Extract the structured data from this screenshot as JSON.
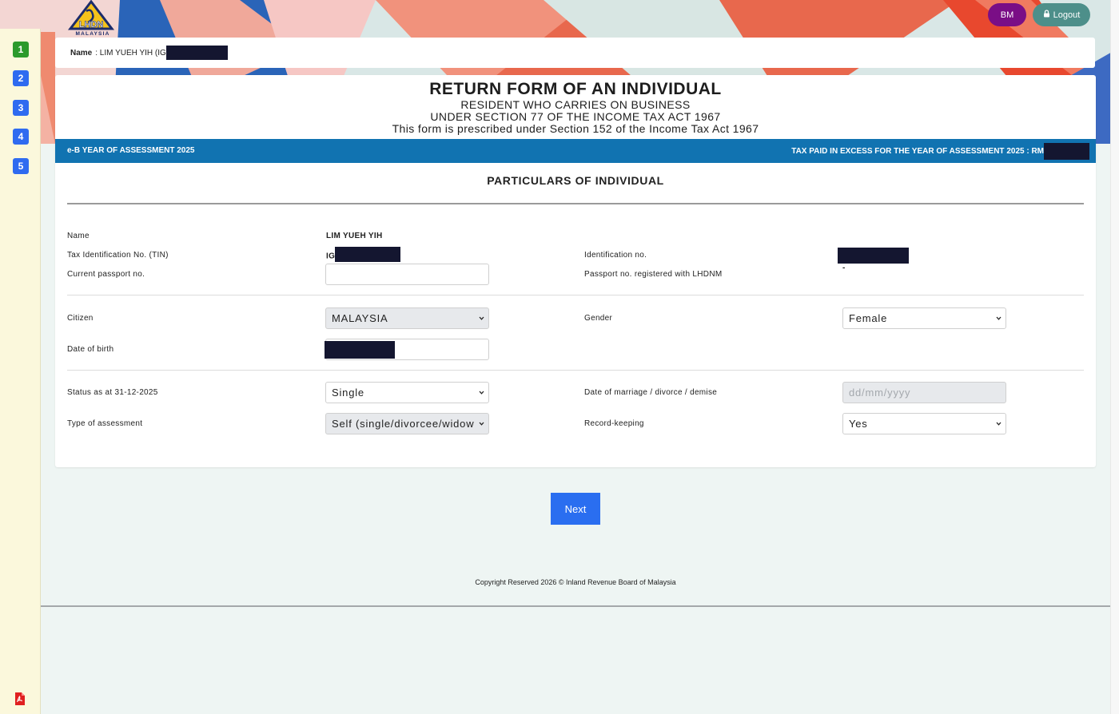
{
  "header": {
    "logo_text": "LHDN",
    "logo_sub": "MALAYSIA",
    "lang_button": "BM",
    "logout_button": "Logout"
  },
  "sidebar": {
    "steps": [
      "1",
      "2",
      "3",
      "4",
      "5"
    ],
    "active_step": "1"
  },
  "namebar": {
    "label": "Name",
    "value": ": LIM YUEH YIH (IG"
  },
  "form": {
    "title": "RETURN FORM OF AN INDIVIDUAL",
    "subtitle1": "RESIDENT WHO CARRIES ON BUSINESS",
    "subtitle2": "UNDER SECTION 77 OF THE INCOME TAX ACT 1967",
    "subtitle3": "This form is prescribed under Section 152 of the Income Tax Act 1967",
    "ya_left": "e-B YEAR OF ASSESSMENT 2025",
    "ya_right": "TAX PAID IN EXCESS FOR THE YEAR OF ASSESSMENT 2025 : RM",
    "section_title": "PARTICULARS OF INDIVIDUAL"
  },
  "fields": {
    "name_label": "Name",
    "name_value": "LIM YUEH YIH",
    "tin_label": "Tax Identification No. (TIN)",
    "tin_value": "IG",
    "id_label": "Identification no.",
    "passport_label": "Current passport no.",
    "passport_value": "",
    "passport_reg_label": "Passport no. registered with LHDNM",
    "passport_reg_value": "-",
    "citizen_label": "Citizen",
    "citizen_value": "MALAYSIA",
    "gender_label": "Gender",
    "gender_value": "Female",
    "dob_label": "Date of birth",
    "status_label": "Status as at 31-12-2025",
    "status_value": "Single",
    "marriage_label": "Date of marriage / divorce / demise",
    "marriage_placeholder": "dd/mm/yyyy",
    "assessment_label": "Type of assessment",
    "assessment_value": "Self (single/divorcee/widow",
    "record_label": "Record-keeping",
    "record_value": "Yes"
  },
  "actions": {
    "next_label": "Next"
  },
  "footer": {
    "copyright": "Copyright Reserved 2026 © Inland Revenue Board of Malaysia"
  },
  "colors": {
    "ya_bar": "#1173b1",
    "next_button": "#2a6ef0",
    "bm_button": "#7a0e86",
    "logout_button": "#4d8f8a",
    "step_active": "#2c9a2c",
    "step_todo": "#2f6bf0"
  }
}
